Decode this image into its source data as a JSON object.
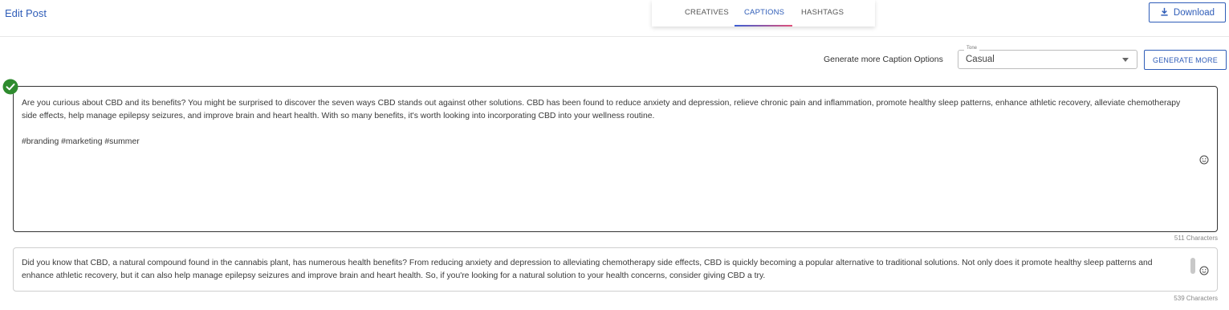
{
  "header": {
    "title": "Edit Post",
    "tabs": [
      {
        "label": "CREATIVES"
      },
      {
        "label": "CAPTIONS"
      },
      {
        "label": "HASHTAGS"
      }
    ],
    "download_label": "Download"
  },
  "toolbar": {
    "generate_label": "Generate more Caption Options",
    "tone_label": "Tone",
    "tone_value": "Casual",
    "generate_button": "GENERATE MORE"
  },
  "captions": [
    {
      "text": "Are you curious about CBD and its benefits? You might be surprised to discover the seven ways CBD stands out against other solutions. CBD has been found to reduce anxiety and depression, relieve chronic pain and inflammation, promote healthy sleep patterns, enhance athletic recovery, alleviate chemotherapy side effects, help manage epilepsy seizures, and improve brain and heart health. With so many benefits, it's worth looking into incorporating CBD into your wellness routine.\n\n#branding #marketing #summer",
      "char_count": "511 Characters",
      "selected": true
    },
    {
      "text": "Did you know that CBD, a natural compound found in the cannabis plant, has numerous health benefits? From reducing anxiety and depression to alleviating chemotherapy side effects, CBD is quickly becoming a popular alternative to traditional solutions. Not only does it promote healthy sleep patterns and enhance athletic recovery, but it can also help manage epilepsy seizures and improve brain and heart health. So, if you're looking for a natural solution to your health concerns, consider giving CBD a try.",
      "char_count": "539 Characters",
      "selected": false
    }
  ],
  "icons": {
    "selected": "check-circle-icon",
    "emoji": "emoji-icon",
    "download": "download-icon",
    "dropdown": "caret-down-icon"
  },
  "colors": {
    "accent": "#2f5db8",
    "selected_check": "#2e8b2e",
    "tab_indicator_start": "#3d5fd4",
    "tab_indicator_end": "#e0507a"
  }
}
